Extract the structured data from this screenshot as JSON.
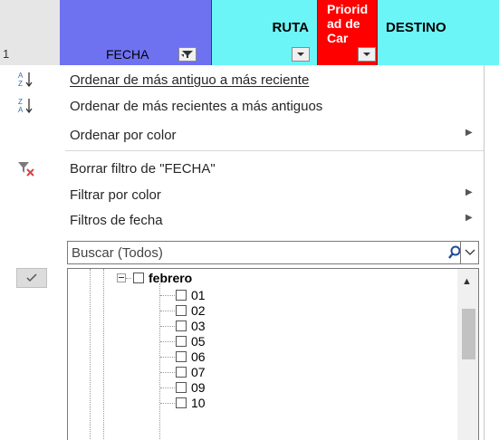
{
  "sheet": {
    "row_number": "1",
    "columns": {
      "fecha": {
        "label": "FECHA",
        "color": "#6f72f0"
      },
      "ruta": {
        "label": "RUTA",
        "color": "#6cf5f7"
      },
      "prioridad": {
        "label": "Priorid ad de Car",
        "color": "#ff0000"
      },
      "destino": {
        "label": "DESTINO",
        "color": "#6cf5f7"
      }
    }
  },
  "menu": {
    "sort_asc": "Ordenar de más antiguo a más reciente",
    "sort_desc": "Ordenar de más recientes a más antiguos",
    "sort_color": "Ordenar por color",
    "clear_filter": "Borrar filtro de \"FECHA\"",
    "filter_color": "Filtrar por color",
    "date_filters": "Filtros de fecha",
    "icons": [
      "sort-az-icon",
      "sort-za-icon",
      "clear-filter-icon",
      "submenu-arrow-icon"
    ]
  },
  "search": {
    "placeholder": "Buscar (Todos)"
  },
  "tree": {
    "month": "febrero",
    "days": [
      "01",
      "02",
      "03",
      "05",
      "06",
      "07",
      "09",
      "10"
    ]
  }
}
